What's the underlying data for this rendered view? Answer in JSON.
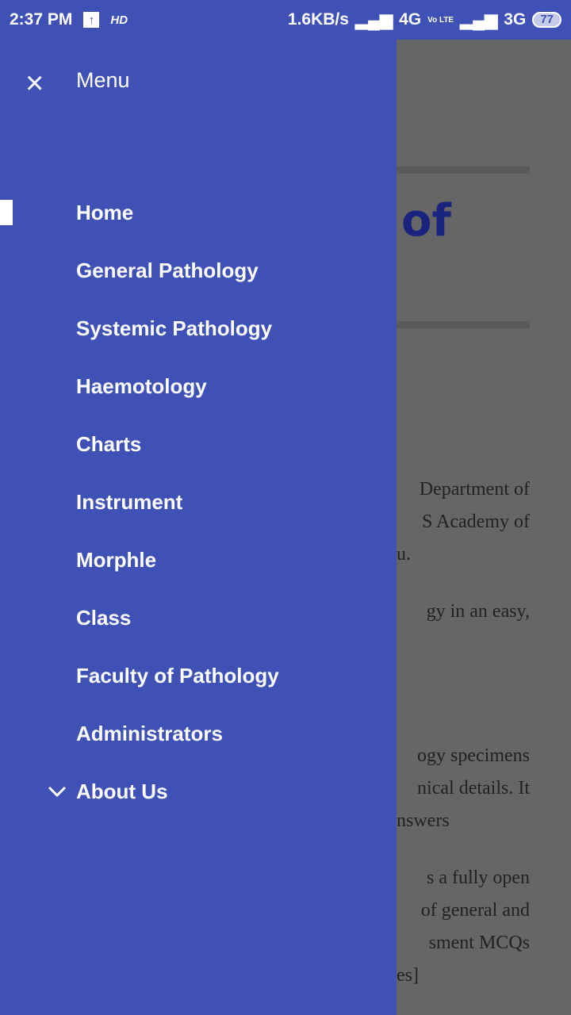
{
  "status": {
    "time": "2:37 PM",
    "upload_icon": "↑",
    "hd": "HD",
    "speed": "1.6KB/s",
    "net1": "4G",
    "volte": "Vo LTE",
    "net2": "3G",
    "battery": "77"
  },
  "drawer": {
    "title": "Menu",
    "close_icon": "×",
    "items": [
      "Home",
      "General Pathology",
      "Systemic Pathology",
      "Haemotology",
      "Charts",
      "Instrument",
      "Morphle",
      "Class",
      "Faculty of Pathology",
      "Administrators",
      "About Us"
    ],
    "selected": "Home"
  },
  "background": {
    "heading": "of",
    "lines": [
      "Department of",
      "S Academy of",
      "u.",
      "gy in an easy,",
      "ogy specimens",
      "nical details. It",
      "nswers",
      "s a fully open",
      "of general and",
      "sment MCQs",
      "es]"
    ]
  }
}
